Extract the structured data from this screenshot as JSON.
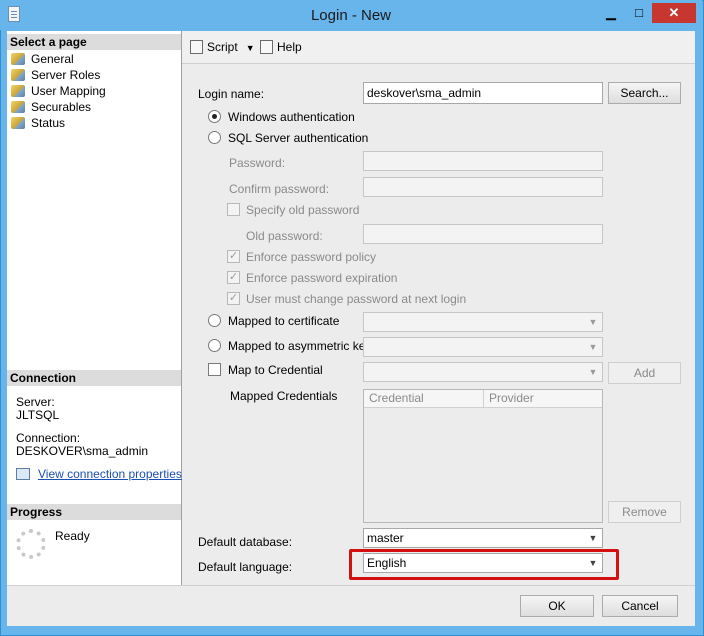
{
  "window": {
    "title": "Login - New",
    "minimize": "▁",
    "maximize": "□",
    "close": "✕"
  },
  "left": {
    "select_page_header": "Select a page",
    "pages": [
      {
        "label": "General"
      },
      {
        "label": "Server Roles"
      },
      {
        "label": "User Mapping"
      },
      {
        "label": "Securables"
      },
      {
        "label": "Status"
      }
    ],
    "connection_header": "Connection",
    "server_label": "Server:",
    "server_value": "JLTSQL",
    "connection_label": "Connection:",
    "connection_value": "DESKOVER\\sma_admin",
    "view_connection_link": "View connection properties",
    "progress_header": "Progress",
    "progress_status": "Ready"
  },
  "toolbar": {
    "script_label": "Script",
    "help_label": "Help"
  },
  "form": {
    "login_name_label": "Login name:",
    "login_name_value": "deskover\\sma_admin",
    "search_button": "Search...",
    "windows_auth": "Windows authentication",
    "sql_auth": "SQL Server authentication",
    "password_label": "Password:",
    "confirm_password_label": "Confirm password:",
    "specify_old_password": "Specify old password",
    "old_password_label": "Old password:",
    "enforce_policy": "Enforce password policy",
    "enforce_expiration": "Enforce password expiration",
    "must_change": "User must change password at next login",
    "mapped_certificate": "Mapped to certificate",
    "mapped_asymmetric_key": "Mapped to asymmetric key",
    "map_credential": "Map to Credential",
    "add_button": "Add",
    "mapped_credentials_label": "Mapped Credentials",
    "grid_columns": [
      "Credential",
      "Provider"
    ],
    "remove_button": "Remove",
    "default_database_label": "Default database:",
    "default_database_value": "master",
    "default_language_label": "Default language:",
    "default_language_value": "English"
  },
  "footer": {
    "ok_button": "OK",
    "cancel_button": "Cancel"
  },
  "colors": {
    "titlebar": "#67b5eb",
    "close_button": "#c7372f",
    "highlight_box": "#d40f0f",
    "link": "#1b4fb5"
  }
}
